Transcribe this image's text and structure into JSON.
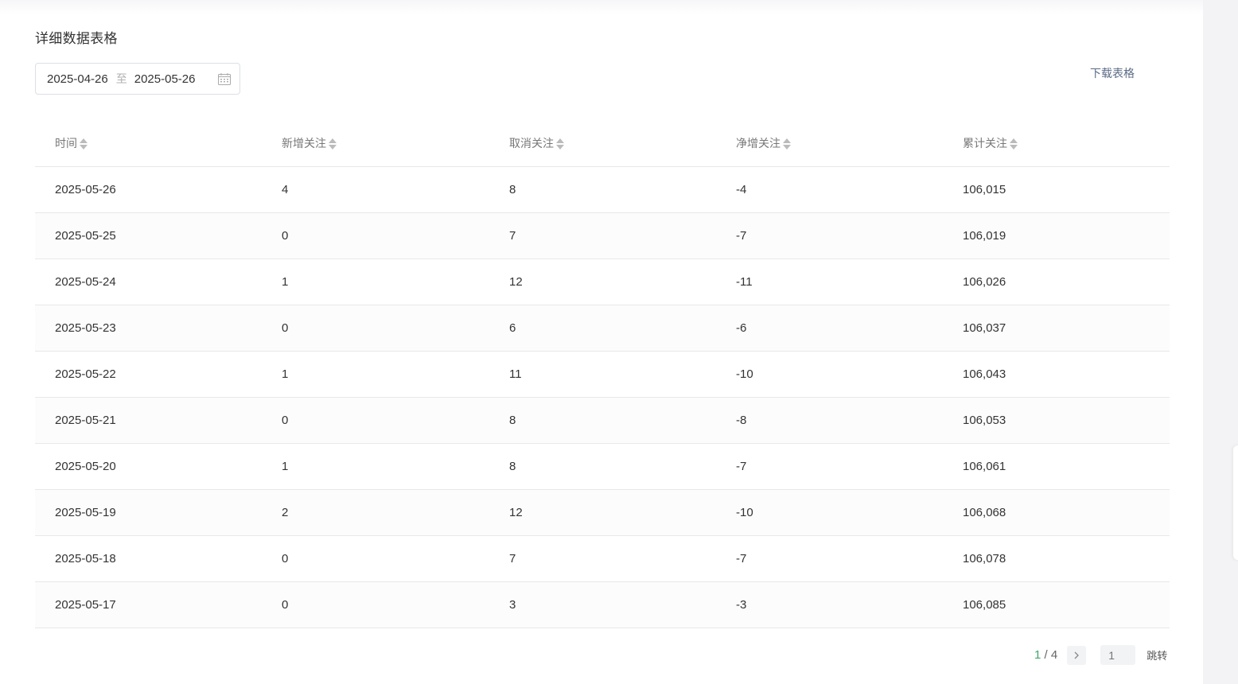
{
  "section": {
    "title": "详细数据表格"
  },
  "date_range": {
    "start": "2025-04-26",
    "separator": "至",
    "end": "2025-05-26"
  },
  "download": {
    "label": "下载表格"
  },
  "table": {
    "headers": [
      "时间",
      "新增关注",
      "取消关注",
      "净增关注",
      "累计关注"
    ],
    "rows": [
      [
        "2025-05-26",
        "4",
        "8",
        "-4",
        "106,015"
      ],
      [
        "2025-05-25",
        "0",
        "7",
        "-7",
        "106,019"
      ],
      [
        "2025-05-24",
        "1",
        "12",
        "-11",
        "106,026"
      ],
      [
        "2025-05-23",
        "0",
        "6",
        "-6",
        "106,037"
      ],
      [
        "2025-05-22",
        "1",
        "11",
        "-10",
        "106,043"
      ],
      [
        "2025-05-21",
        "0",
        "8",
        "-8",
        "106,053"
      ],
      [
        "2025-05-20",
        "1",
        "8",
        "-7",
        "106,061"
      ],
      [
        "2025-05-19",
        "2",
        "12",
        "-10",
        "106,068"
      ],
      [
        "2025-05-18",
        "0",
        "7",
        "-7",
        "106,078"
      ],
      [
        "2025-05-17",
        "0",
        "3",
        "-3",
        "106,085"
      ]
    ]
  },
  "pagination": {
    "current": "1",
    "divider": " / ",
    "total": "4",
    "jump_placeholder": "1",
    "jump_label": "跳转"
  },
  "icons": {
    "calendar": "calendar-icon",
    "sort": "sort-icon",
    "next": "chevron-right-icon"
  },
  "colors": {
    "accent": "#3fa66a",
    "link": "#5b6b86",
    "border": "#e8e8e8"
  }
}
